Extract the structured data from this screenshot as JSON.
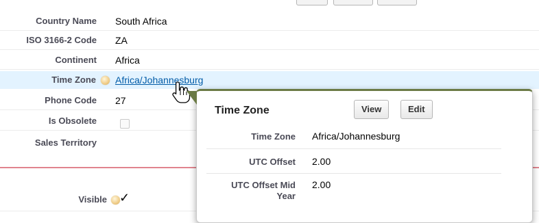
{
  "fields": [
    {
      "label": "Country Name",
      "value": "South Africa"
    },
    {
      "label": "ISO 3166-2 Code",
      "value": "ZA"
    },
    {
      "label": "Continent",
      "value": "Africa"
    },
    {
      "label": "Time Zone",
      "value": "Africa/Johannesburg"
    },
    {
      "label": "Phone Code",
      "value": "27"
    },
    {
      "label": "Is Obsolete",
      "value": ""
    },
    {
      "label": "Sales Territory",
      "value": ""
    }
  ],
  "visible": {
    "label": "Visible",
    "checked": true
  },
  "popup": {
    "title": "Time Zone",
    "view_label": "View",
    "edit_label": "Edit",
    "fields": [
      {
        "label": "Time Zone",
        "value": "Africa/Johannesburg"
      },
      {
        "label": "UTC Offset",
        "value": "2.00"
      },
      {
        "label": "UTC Offset Mid Year",
        "value": "2.00"
      }
    ]
  },
  "colors": {
    "link": "#015ba7",
    "hover_row": "#e3f3ff",
    "label": "#4a4a56",
    "section_divider": "#e0848e",
    "popup_accent": "#6b7a45"
  }
}
